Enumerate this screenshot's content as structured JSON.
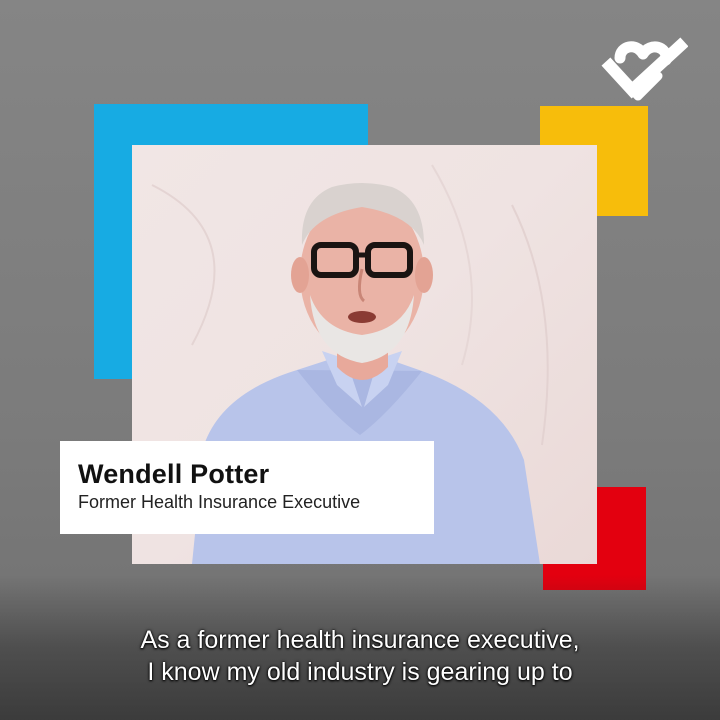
{
  "lower_third": {
    "name": "Wendell Potter",
    "title": "Former Health Insurance Executive"
  },
  "caption": {
    "line1": "As a former health insurance executive,",
    "line2": "I know my old industry is gearing up to"
  },
  "logo": {
    "icon": "heart-check-icon",
    "color": "#ffffff"
  },
  "colors": {
    "background": "#7a7a7a",
    "blue_block": "#17abe3",
    "yellow_block": "#f7bd0b",
    "red_block": "#e3000f",
    "photo_backdrop": "#f0e4e3",
    "shirt": "#b7c3ea"
  }
}
